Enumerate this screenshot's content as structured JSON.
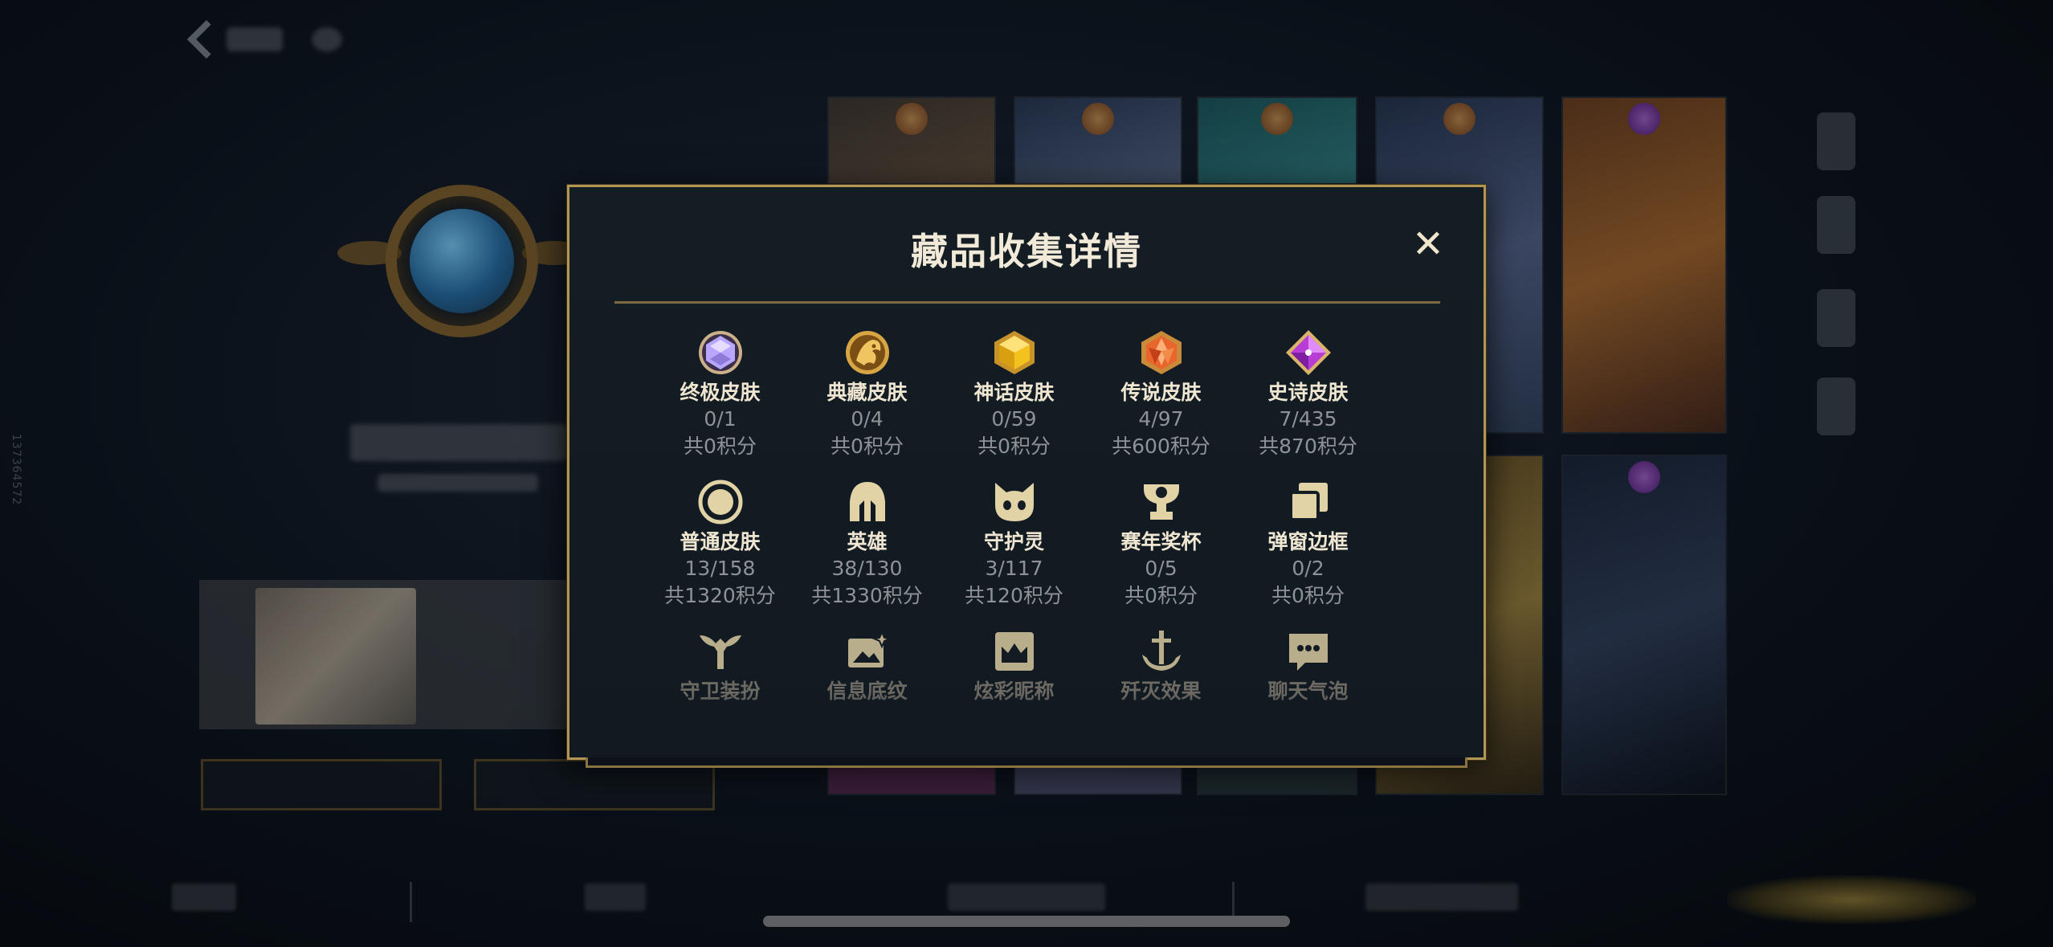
{
  "side_id": "137364572",
  "dialog": {
    "title": "藏品收集详情",
    "close_symbol": "✕",
    "categories": [
      {
        "name": "终极皮肤",
        "count": "0/1",
        "points": "共0积分",
        "icon": "ultimate-gem-icon",
        "color": "#b9a6ff"
      },
      {
        "name": "典藏皮肤",
        "count": "0/4",
        "points": "共0积分",
        "icon": "dragon-emblem-icon",
        "color": "#d8a545"
      },
      {
        "name": "神话皮肤",
        "count": "0/59",
        "points": "共0积分",
        "icon": "mythic-gem-icon",
        "color": "#f3c21e"
      },
      {
        "name": "传说皮肤",
        "count": "4/97",
        "points": "共600积分",
        "icon": "legendary-gem-icon",
        "color": "#e8652b"
      },
      {
        "name": "史诗皮肤",
        "count": "7/435",
        "points": "共870积分",
        "icon": "epic-gem-icon",
        "color": "#b83dd6"
      },
      {
        "name": "普通皮肤",
        "count": "13/158",
        "points": "共1320积分",
        "icon": "circle-badge-icon",
        "color": "#e2d3a6"
      },
      {
        "name": "英雄",
        "count": "38/130",
        "points": "共1330积分",
        "icon": "helmet-icon",
        "color": "#e2d3a6"
      },
      {
        "name": "守护灵",
        "count": "3/117",
        "points": "共120积分",
        "icon": "guardian-pet-icon",
        "color": "#e2d3a6"
      },
      {
        "name": "赛年奖杯",
        "count": "0/5",
        "points": "共0积分",
        "icon": "trophy-icon",
        "color": "#e2d3a6"
      },
      {
        "name": "弹窗边框",
        "count": "0/2",
        "points": "共0积分",
        "icon": "layered-frames-icon",
        "color": "#e2d3a6"
      },
      {
        "name": "守卫装扮",
        "icon": "ward-icon",
        "color": "#e2d3a6"
      },
      {
        "name": "信息底纹",
        "icon": "card-sparkle-icon",
        "color": "#e2d3a6"
      },
      {
        "name": "炫彩昵称",
        "icon": "crown-frame-icon",
        "color": "#e2d3a6"
      },
      {
        "name": "歼灭效果",
        "icon": "anchor-sword-icon",
        "color": "#e2d3a6"
      },
      {
        "name": "聊天气泡",
        "icon": "chat-bubble-icon",
        "color": "#e2d3a6"
      }
    ]
  },
  "colors": {
    "gold_border": "#b49654",
    "title_text": "#f2ead8",
    "muted_text": "#8f9296"
  }
}
